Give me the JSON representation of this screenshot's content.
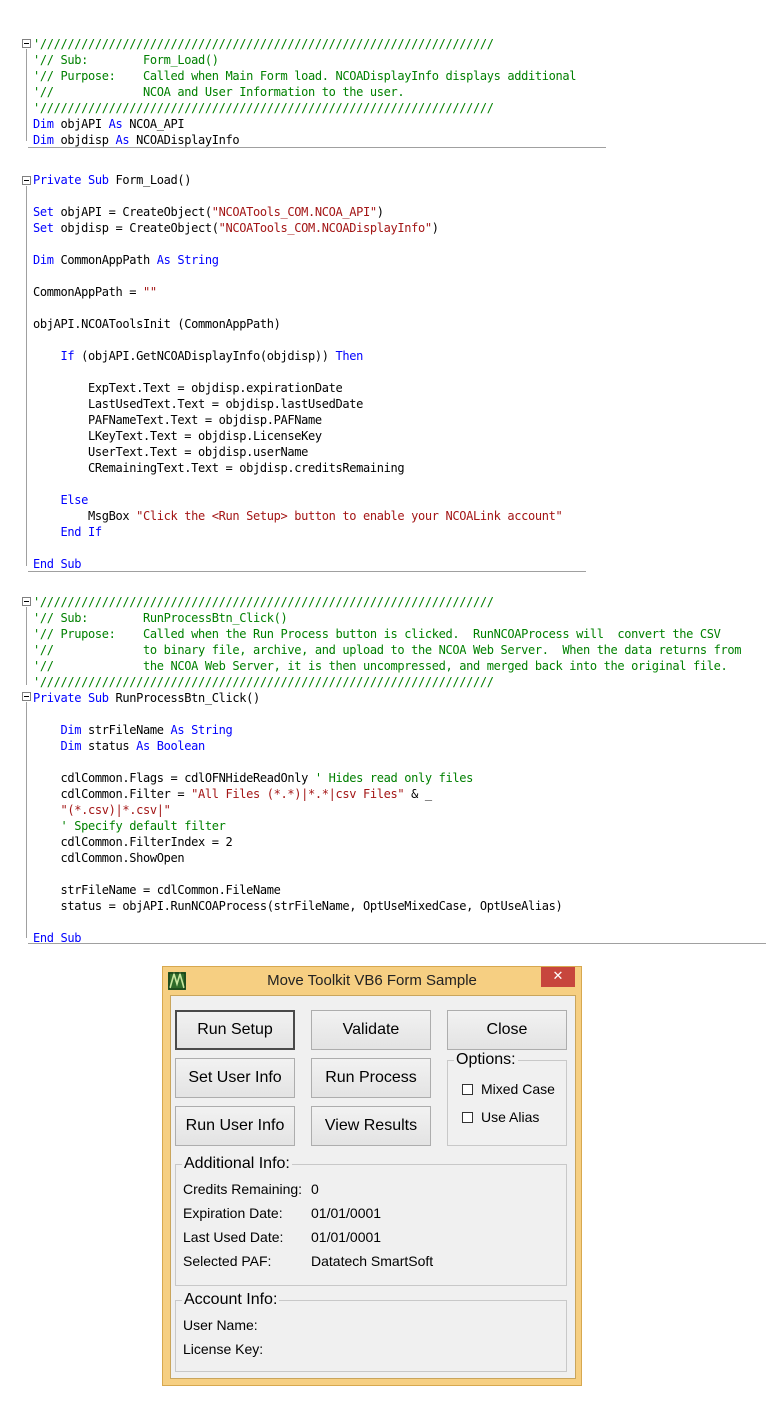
{
  "code": {
    "block1": [
      [
        [
          "cm",
          "'//////////////////////////////////////////////////////////////////"
        ]
      ],
      [
        [
          "cm",
          "'// Sub:        Form_Load()"
        ]
      ],
      [
        [
          "cm",
          "'// Purpose:    Called when Main Form load. NCOADisplayInfo displays additional"
        ]
      ],
      [
        [
          "cm",
          "'//             NCOA and User Information to the user."
        ]
      ],
      [
        [
          "cm",
          "'//////////////////////////////////////////////////////////////////"
        ]
      ],
      [
        [
          "kw",
          "Dim"
        ],
        [
          "tx",
          " objAPI "
        ],
        [
          "kw",
          "As"
        ],
        [
          "tx",
          " NCOA_API"
        ]
      ],
      [
        [
          "kw",
          "Dim"
        ],
        [
          "tx",
          " objdisp "
        ],
        [
          "kw",
          "As"
        ],
        [
          "tx",
          " NCOADisplayInfo"
        ]
      ]
    ],
    "block2": [
      [
        [
          "kw",
          "Private Sub"
        ],
        [
          "tx",
          " Form_Load()"
        ]
      ],
      [],
      [
        [
          "kw",
          "Set"
        ],
        [
          "tx",
          " objAPI = CreateObject("
        ],
        [
          "st",
          "\"NCOATools_COM.NCOA_API\""
        ],
        [
          "tx",
          ")"
        ]
      ],
      [
        [
          "kw",
          "Set"
        ],
        [
          "tx",
          " objdisp = CreateObject("
        ],
        [
          "st",
          "\"NCOATools_COM.NCOADisplayInfo\""
        ],
        [
          "tx",
          ")"
        ]
      ],
      [],
      [
        [
          "kw",
          "Dim"
        ],
        [
          "tx",
          " CommonAppPath "
        ],
        [
          "kw",
          "As String"
        ]
      ],
      [],
      [
        [
          "tx",
          "CommonAppPath = "
        ],
        [
          "st",
          "\"\""
        ]
      ],
      [],
      [
        [
          "tx",
          "objAPI.NCOAToolsInit (CommonAppPath)"
        ]
      ],
      [],
      [
        [
          "tx",
          "    "
        ],
        [
          "kw",
          "If"
        ],
        [
          "tx",
          " (objAPI.GetNCOADisplayInfo(objdisp)) "
        ],
        [
          "kw",
          "Then"
        ]
      ],
      [],
      [
        [
          "tx",
          "        ExpText.Text = objdisp.expirationDate"
        ]
      ],
      [
        [
          "tx",
          "        LastUsedText.Text = objdisp.lastUsedDate"
        ]
      ],
      [
        [
          "tx",
          "        PAFNameText.Text = objdisp.PAFName"
        ]
      ],
      [
        [
          "tx",
          "        LKeyText.Text = objdisp.LicenseKey"
        ]
      ],
      [
        [
          "tx",
          "        UserText.Text = objdisp.userName"
        ]
      ],
      [
        [
          "tx",
          "        CRemainingText.Text = objdisp.creditsRemaining"
        ]
      ],
      [],
      [
        [
          "tx",
          "    "
        ],
        [
          "kw",
          "Else"
        ]
      ],
      [
        [
          "tx",
          "        MsgBox "
        ],
        [
          "st",
          "\"Click the <Run Setup> button to enable your NCOALink account\""
        ]
      ],
      [
        [
          "tx",
          "    "
        ],
        [
          "kw",
          "End If"
        ]
      ],
      [],
      [
        [
          "kw",
          "End Sub"
        ]
      ]
    ],
    "block3": [
      [
        [
          "cm",
          "'//////////////////////////////////////////////////////////////////"
        ]
      ],
      [
        [
          "cm",
          "'// Sub:        RunProcessBtn_Click()"
        ]
      ],
      [
        [
          "cm",
          "'// Prupose:    Called when the Run Process button is clicked.  RunNCOAProcess will  convert the CSV"
        ]
      ],
      [
        [
          "cm",
          "'//             to binary file, archive, and upload to the NCOA Web Server.  When the data returns from"
        ]
      ],
      [
        [
          "cm",
          "'//             the NCOA Web Server, it is then uncompressed, and merged back into the original file."
        ]
      ],
      [
        [
          "cm",
          "'//////////////////////////////////////////////////////////////////"
        ]
      ],
      [
        [
          "kw",
          "Private Sub"
        ],
        [
          "tx",
          " RunProcessBtn_Click()"
        ]
      ],
      [],
      [
        [
          "tx",
          "    "
        ],
        [
          "kw",
          "Dim"
        ],
        [
          "tx",
          " strFileName "
        ],
        [
          "kw",
          "As String"
        ]
      ],
      [
        [
          "tx",
          "    "
        ],
        [
          "kw",
          "Dim"
        ],
        [
          "tx",
          " status "
        ],
        [
          "kw",
          "As Boolean"
        ]
      ],
      [],
      [
        [
          "tx",
          "    cdlCommon.Flags = cdlOFNHideReadOnly "
        ],
        [
          "cm",
          "' Hides read only files"
        ]
      ],
      [
        [
          "tx",
          "    cdlCommon.Filter = "
        ],
        [
          "st",
          "\"All Files (*.*)|*.*|csv Files\""
        ],
        [
          "tx",
          " & _"
        ]
      ],
      [
        [
          "tx",
          "    "
        ],
        [
          "st",
          "\"(*.csv)|*.csv|\""
        ]
      ],
      [
        [
          "tx",
          "    "
        ],
        [
          "cm",
          "' Specify default filter"
        ]
      ],
      [
        [
          "tx",
          "    cdlCommon.FilterIndex = 2"
        ]
      ],
      [
        [
          "tx",
          "    cdlCommon.ShowOpen"
        ]
      ],
      [],
      [
        [
          "tx",
          "    strFileName = cdlCommon.FileName"
        ]
      ],
      [
        [
          "tx",
          "    status = objAPI.RunNCOAProcess(strFileName, OptUseMixedCase, OptUseAlias)"
        ]
      ],
      [],
      [
        [
          "kw",
          "End Sub"
        ]
      ]
    ]
  },
  "window": {
    "title": "Move Toolkit VB6 Form Sample",
    "close_glyph": "✕",
    "buttons": {
      "run_setup": "Run Setup",
      "validate": "Validate",
      "close": "Close",
      "set_user_info": "Set User Info",
      "run_process": "Run Process",
      "run_user_info": "Run User Info",
      "view_results": "View Results"
    },
    "options": {
      "legend": "Options:",
      "mixed_case": "Mixed Case",
      "use_alias": "Use Alias"
    },
    "additional_info": {
      "legend": "Additional Info:",
      "credits_label": "Credits Remaining:",
      "credits_value": "0",
      "expiration_label": "Expiration Date:",
      "expiration_value": "01/01/0001",
      "last_used_label": "Last Used Date:",
      "last_used_value": "01/01/0001",
      "paf_label": "Selected PAF:",
      "paf_value": "Datatech SmartSoft"
    },
    "account_info": {
      "legend": "Account Info:",
      "user_label": "User Name:",
      "license_label": "License Key:"
    }
  },
  "colors": {
    "keyword": "#0000ff",
    "comment": "#008000",
    "string": "#a31515",
    "window_frame": "#f6cf82",
    "close_button": "#c7463d"
  }
}
